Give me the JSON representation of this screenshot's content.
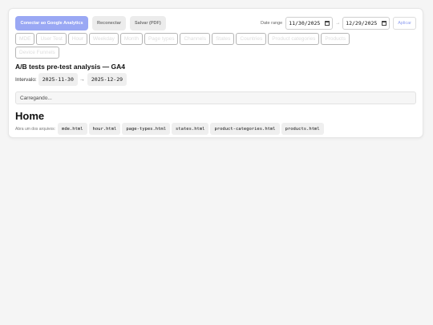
{
  "toolbar": {
    "connect_label": "Conectar ao Google Analytics",
    "reconnect_label": "Reconectar",
    "save_pdf_label": "Salvar (PDF)",
    "date_range_label": "Date range",
    "start_date": "11/30/2025",
    "end_date": "12/29/2025",
    "arrow": "→",
    "apply_label": "Aplicar"
  },
  "tabs": [
    {
      "label": "MDE"
    },
    {
      "label": "User Test"
    },
    {
      "label": "Hour"
    },
    {
      "label": "Weekday"
    },
    {
      "label": "Month"
    },
    {
      "label": "Page types"
    },
    {
      "label": "Channels"
    },
    {
      "label": "States"
    },
    {
      "label": "Countries"
    },
    {
      "label": "Product categories"
    },
    {
      "label": "Products"
    },
    {
      "label": "Device Funnels"
    }
  ],
  "main": {
    "title": "A/B tests pre-test analysis — GA4",
    "interval_label": "Intervalo:",
    "interval_start": "2025-11-30",
    "interval_arrow": "→",
    "interval_end": "2025-12-29",
    "loading_text": "Carregando..."
  },
  "home": {
    "heading": "Home",
    "files_label": "Abra um dos arquivos:",
    "files": [
      "mde.html",
      "hour.html",
      "page-types.html",
      "states.html",
      "product-categories.html",
      "products.html"
    ]
  },
  "colors": {
    "primary": "#9aa8f4",
    "apply_text": "#8e9ef0",
    "background": "#f5f5f5"
  }
}
